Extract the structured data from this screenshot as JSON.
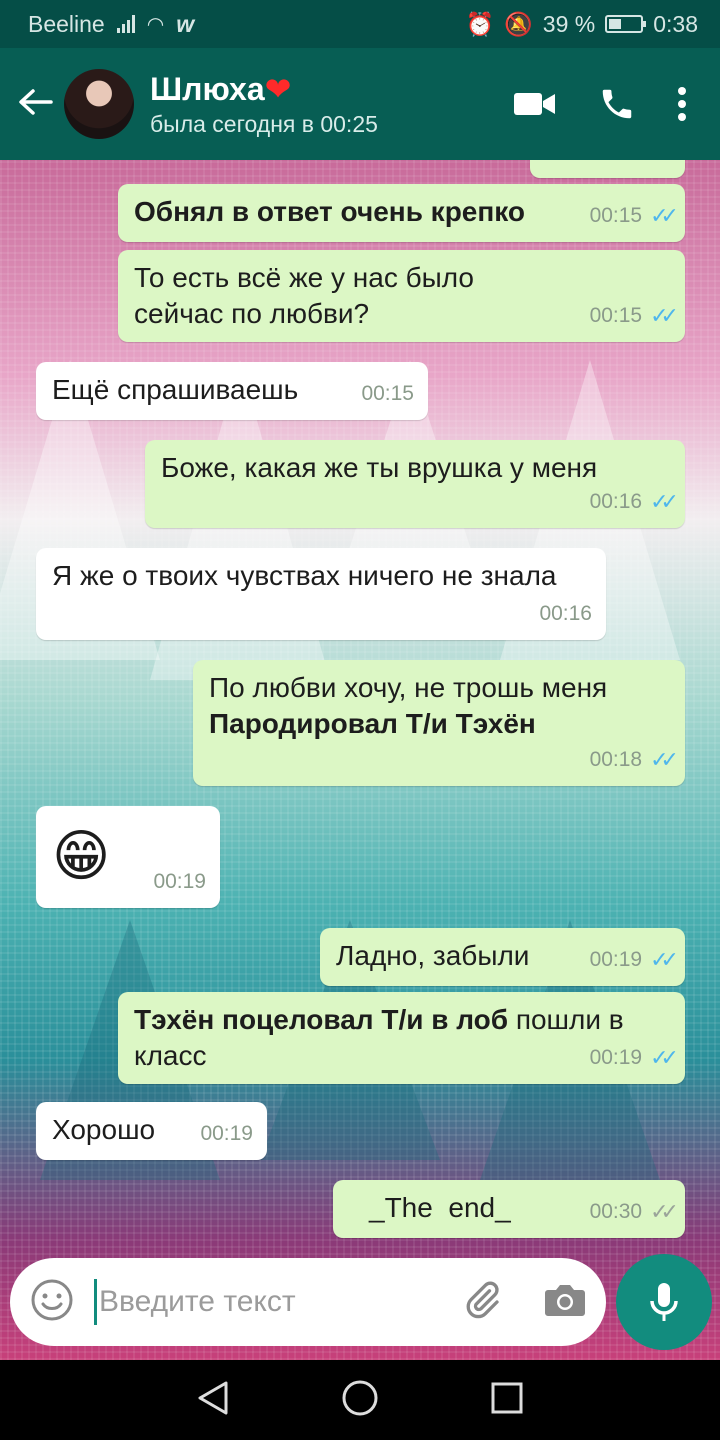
{
  "status_bar": {
    "carrier": "Beeline",
    "battery_percent": "39 %",
    "battery_level": 0.39,
    "time": "0:38"
  },
  "header": {
    "contact_name": "Шлюха",
    "contact_emoji": "❤",
    "last_seen": "была сегодня в 00:25"
  },
  "messages": [
    {
      "dir": "out",
      "bold": "Обнял в ответ очень крепко",
      "text": "",
      "time": "00:15",
      "status": "read"
    },
    {
      "dir": "out",
      "bold": "",
      "text": "То есть всё же у нас было сейчас по любви?",
      "time": "00:15",
      "status": "read"
    },
    {
      "dir": "in",
      "bold": "",
      "text": "Ещё спрашиваешь",
      "time": "00:15"
    },
    {
      "dir": "out",
      "bold": "",
      "text": "Боже, какая же ты врушка у меня",
      "time": "00:16",
      "status": "read"
    },
    {
      "dir": "in",
      "bold": "",
      "text": "Я же о твоих чувствах ничего не знала",
      "time": "00:16"
    },
    {
      "dir": "out",
      "text": "По любви хочу, не трошь меня",
      "bold": "Пародировал Т/и Тэхён",
      "time": "00:18",
      "status": "read"
    },
    {
      "dir": "in",
      "emoji": "😁",
      "time": "00:19"
    },
    {
      "dir": "out",
      "bold": "",
      "text": "Ладно, забыли",
      "time": "00:19",
      "status": "read"
    },
    {
      "dir": "out",
      "bold": "Тэхён поцеловал Т/и в лоб",
      "text": "пошли в класс",
      "time": "00:19",
      "status": "read"
    },
    {
      "dir": "in",
      "bold": "",
      "text": "Хорошо",
      "time": "00:19"
    },
    {
      "dir": "out",
      "bold": "",
      "text": "_The  end_",
      "time": "00:30",
      "status": "delivered"
    }
  ],
  "input": {
    "placeholder": "Введите текст"
  },
  "colors": {
    "header": "#075e54",
    "outgoing_bubble": "#dcf7c5",
    "incoming_bubble": "#ffffff",
    "accent": "#128c7e",
    "read_tick": "#4fb6ec"
  }
}
